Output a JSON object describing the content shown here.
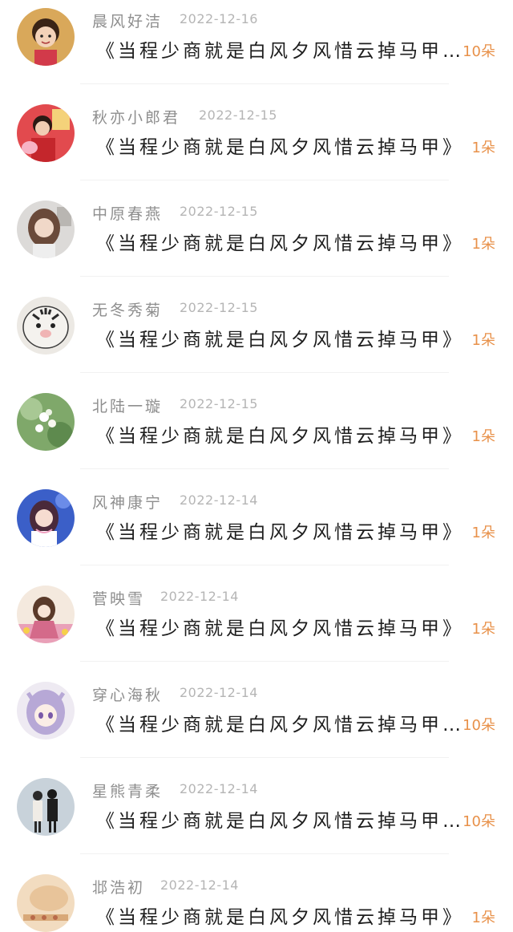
{
  "colors": {
    "count": "#e8914a",
    "name": "#8e8e8e",
    "date": "#b5b5b5",
    "title": "#1e1e1e"
  },
  "rows": [
    {
      "name": "晨风好洁",
      "date": "2022-12-16",
      "title": "《当程少商就是白风夕风惜云掉马甲…",
      "count": "10朵"
    },
    {
      "name": "秋亦小郎君",
      "date": "2022-12-15",
      "title": "《当程少商就是白风夕风惜云掉马甲》",
      "count": "1朵"
    },
    {
      "name": "中原春燕",
      "date": "2022-12-15",
      "title": "《当程少商就是白风夕风惜云掉马甲》",
      "count": "1朵"
    },
    {
      "name": "无冬秀菊",
      "date": "2022-12-15",
      "title": "《当程少商就是白风夕风惜云掉马甲》",
      "count": "1朵"
    },
    {
      "name": "北陆一璇",
      "date": "2022-12-15",
      "title": "《当程少商就是白风夕风惜云掉马甲》",
      "count": "1朵"
    },
    {
      "name": "风神康宁",
      "date": "2022-12-14",
      "title": "《当程少商就是白风夕风惜云掉马甲》",
      "count": "1朵"
    },
    {
      "name": "菅映雪",
      "date": "2022-12-14",
      "title": "《当程少商就是白风夕风惜云掉马甲》",
      "count": "1朵"
    },
    {
      "name": "穿心海秋",
      "date": "2022-12-14",
      "title": "《当程少商就是白风夕风惜云掉马甲…",
      "count": "10朵"
    },
    {
      "name": "星熊青柔",
      "date": "2022-12-14",
      "title": "《当程少商就是白风夕风惜云掉马甲…",
      "count": "10朵"
    },
    {
      "name": "邶浩初",
      "date": "2022-12-14",
      "title": "《当程少商就是白风夕风惜云掉马甲》",
      "count": "1朵"
    }
  ]
}
